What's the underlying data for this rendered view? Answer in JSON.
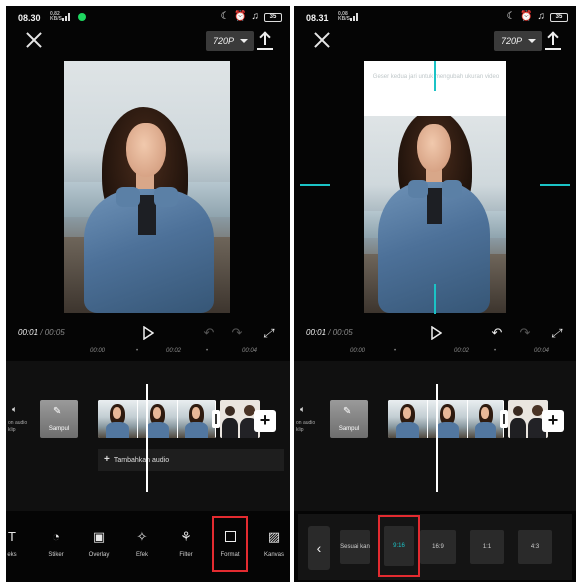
{
  "left": {
    "status": {
      "time": "08.30",
      "signal": "0,82\nKB/S",
      "battery": "35"
    },
    "resolution": "720P",
    "playback": {
      "current": "00:01",
      "total": "00:05"
    },
    "ruler": [
      "00:00",
      "00:02",
      "00:04"
    ],
    "timeline": {
      "volume_label": "on audio\nklip",
      "cover_label": "Sampul",
      "add_audio": "Tambahkan audio"
    },
    "tools": [
      {
        "label": "eks",
        "icon": "text-icon"
      },
      {
        "label": "Stiker",
        "icon": "sticker-icon"
      },
      {
        "label": "Overlay",
        "icon": "overlay-icon"
      },
      {
        "label": "Efek",
        "icon": "effect-icon"
      },
      {
        "label": "Filter",
        "icon": "filter-icon"
      },
      {
        "label": "Format",
        "icon": "format-icon"
      },
      {
        "label": "Kanvas",
        "icon": "canvas-icon"
      }
    ]
  },
  "right": {
    "status": {
      "time": "08.31",
      "signal": "0,08\nKB/S",
      "battery": "35"
    },
    "resolution": "720P",
    "playback": {
      "current": "00:01",
      "total": "00:05"
    },
    "ruler": [
      "00:00",
      "00:02",
      "00:04"
    ],
    "timeline": {
      "volume_label": "on audio\nklip",
      "cover_label": "Sampul"
    },
    "preview_hint": "Geser kedua jari untuk mengubah ukuran video",
    "formats": [
      "Sesuai kan",
      "9:16",
      "16:9",
      "1:1",
      "4:3"
    ],
    "selected_format": "9:16"
  },
  "colors": {
    "accent": "#1bc3c6",
    "highlight": "#e32b30",
    "background": "#050505"
  }
}
